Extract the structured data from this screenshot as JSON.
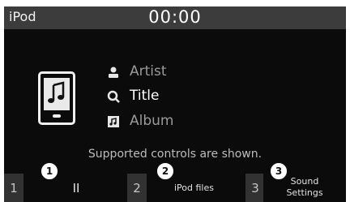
{
  "status_bar": {
    "source": "iPod",
    "clock": "00:00"
  },
  "now_playing": {
    "artist": "Artist",
    "title": "Title",
    "album": "Album"
  },
  "hint": "Supported controls are shown.",
  "controls": [
    {
      "number": "1",
      "label": "II",
      "callout": "1"
    },
    {
      "number": "2",
      "label": "iPod files",
      "callout": "2"
    },
    {
      "number": "3",
      "label_line1": "Sound",
      "label_line2": "Settings",
      "callout": "3"
    }
  ],
  "icons": {
    "album_art": "music-player-icon",
    "artist": "person-icon",
    "title": "music-search-icon",
    "album": "album-icon"
  },
  "colors": {
    "background": "#0b0b0b",
    "status_bar": "#3c3c3c",
    "tile": "#323232"
  }
}
